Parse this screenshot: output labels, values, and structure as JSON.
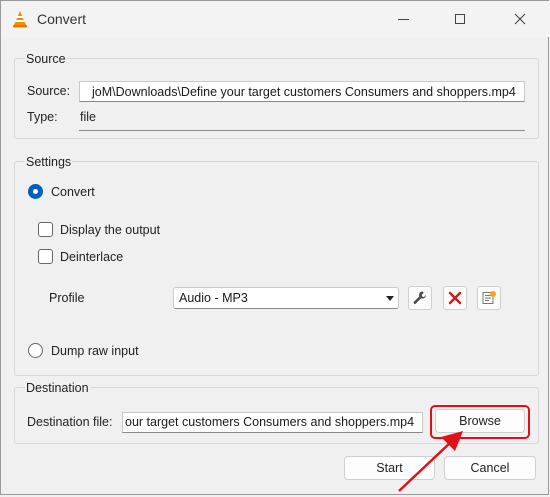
{
  "window": {
    "title": "Convert",
    "controls": {
      "minimize_icon": "minimize-icon",
      "maximize_icon": "maximize-icon",
      "close_icon": "close-icon"
    }
  },
  "source": {
    "group_title": "Source",
    "source_label": "Source:",
    "source_value": "joM\\Downloads\\Define your target customers Consumers and shoppers.mp4",
    "type_label": "Type:",
    "type_value": "file"
  },
  "settings": {
    "group_title": "Settings",
    "convert_label": "Convert",
    "convert_selected": true,
    "display_output_label": "Display the output",
    "display_output_checked": false,
    "deinterlace_label": "Deinterlace",
    "deinterlace_checked": false,
    "profile_label": "Profile",
    "profile_value": "Audio - MP3",
    "dump_raw_label": "Dump raw input",
    "dump_raw_selected": false
  },
  "destination": {
    "group_title": "Destination",
    "file_label": "Destination file:",
    "file_value": "our target customers Consumers and shoppers.mp4",
    "browse_label": "Browse"
  },
  "footer": {
    "start_label": "Start",
    "cancel_label": "Cancel"
  },
  "colors": {
    "accent": "#005fb8",
    "annotation_red": "#e0101a",
    "delete_red": "#d11a1a"
  }
}
